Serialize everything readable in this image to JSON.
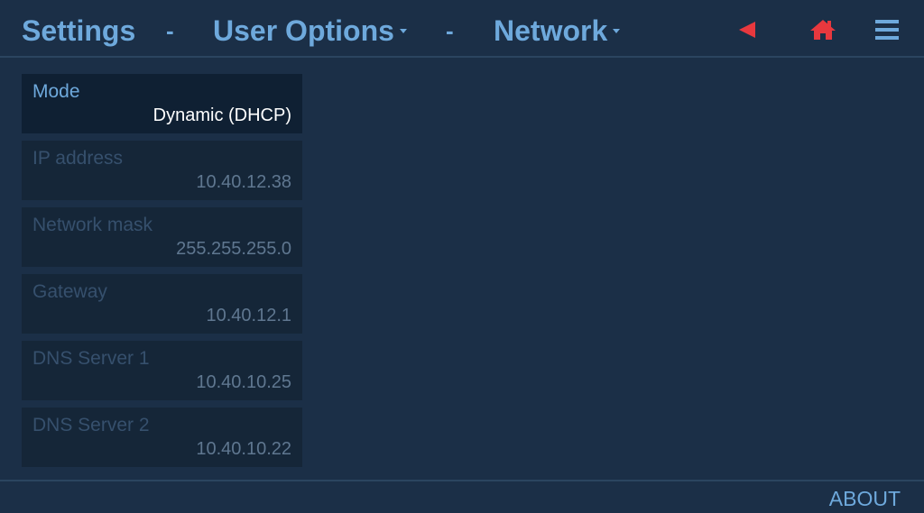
{
  "header": {
    "breadcrumb": [
      {
        "label": "Settings",
        "dropdown": false
      },
      {
        "label": "User Options",
        "dropdown": true
      },
      {
        "label": "Network",
        "dropdown": true
      }
    ],
    "separator": "-",
    "icons": {
      "back": "back-triangle-icon",
      "home": "home-icon",
      "menu": "hamburger-menu-icon"
    },
    "colors": {
      "accent": "#6ea9dc",
      "alert": "#e8383e"
    }
  },
  "fields": [
    {
      "label": "Mode",
      "value": "Dynamic (DHCP)",
      "active": true
    },
    {
      "label": "IP address",
      "value": "10.40.12.38",
      "active": false
    },
    {
      "label": "Network mask",
      "value": "255.255.255.0",
      "active": false
    },
    {
      "label": "Gateway",
      "value": "10.40.12.1",
      "active": false
    },
    {
      "label": "DNS Server 1",
      "value": "10.40.10.25",
      "active": false
    },
    {
      "label": "DNS Server 2",
      "value": "10.40.10.22",
      "active": false
    }
  ],
  "footer": {
    "about_label": "ABOUT"
  }
}
